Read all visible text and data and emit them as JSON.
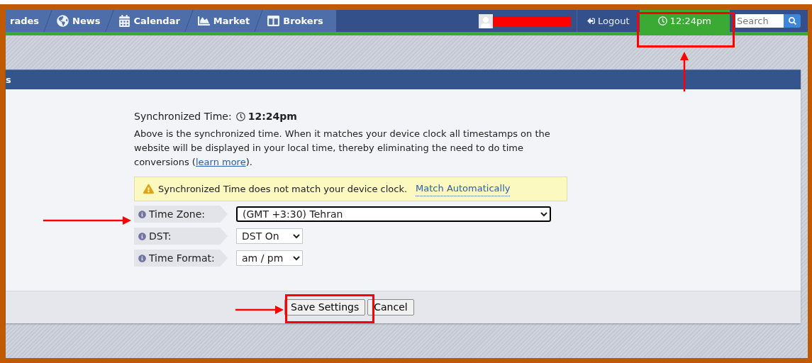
{
  "nav": {
    "items": [
      {
        "label": "rades"
      },
      {
        "label": "News"
      },
      {
        "label": "Calendar"
      },
      {
        "label": "Market"
      },
      {
        "label": "Brokers"
      }
    ],
    "logout": "Logout",
    "clock": {
      "time": "12:24pm",
      "selected": true
    },
    "search": {
      "placeholder": "Search"
    }
  },
  "panel": {
    "title": "s",
    "sync": {
      "label": "Synchronized Time:",
      "time": "12:24pm"
    },
    "description": {
      "before": "Above is the synchronized time. When it matches your device clock all timestamps on the website will be displayed in your local time, thereby eliminating the need to do time conversions (",
      "link": "learn more",
      "after": ")."
    },
    "warning": {
      "text": "Synchronized Time does not match your device clock.",
      "link": "Match Automatically"
    },
    "fields": [
      {
        "label": "Time Zone:",
        "value": "(GMT +3:30) Tehran",
        "kind": "wide",
        "focused": true
      },
      {
        "label": "DST:",
        "value": "DST On",
        "kind": "narrow",
        "focused": false
      },
      {
        "label": "Time Format:",
        "value": "am / pm",
        "kind": "narrow",
        "focused": false
      }
    ],
    "buttons": [
      {
        "label": "Save Settings"
      },
      {
        "label": "Cancel"
      }
    ]
  }
}
